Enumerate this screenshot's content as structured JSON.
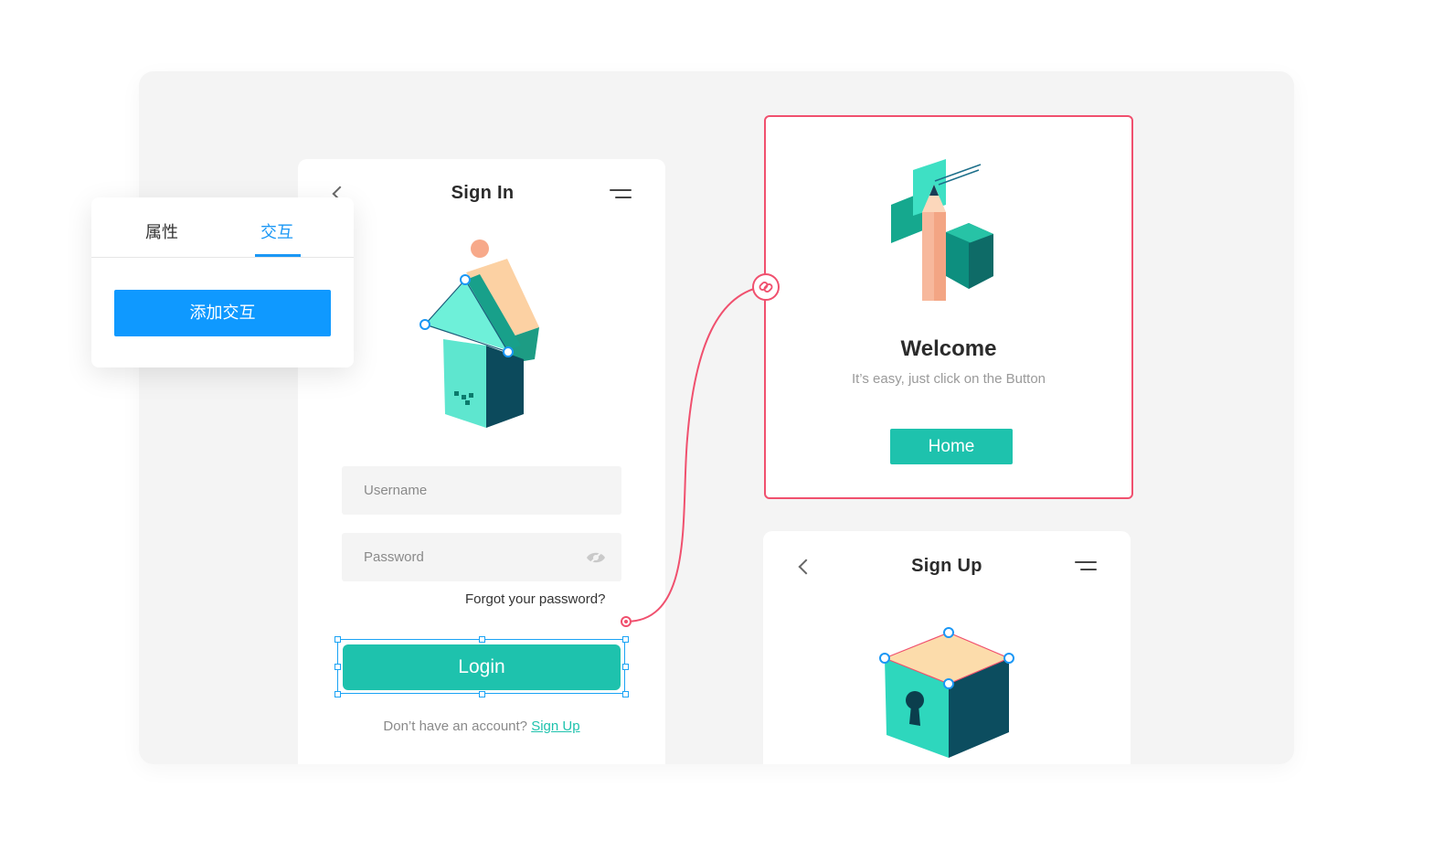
{
  "signin": {
    "title": "Sign In",
    "username_placeholder": "Username",
    "password_placeholder": "Password",
    "forgot_label": "Forgot your password?",
    "login_label": "Login",
    "no_account_text": "Don’t have an account?",
    "signup_link": "Sign Up"
  },
  "properties_panel": {
    "tabs": [
      "属性",
      "交互"
    ],
    "active_tab": "交互",
    "add_interaction_label": "添加交互"
  },
  "welcome": {
    "title": "Welcome",
    "subtitle": "It’s easy, just click on the Button",
    "home_label": "Home"
  },
  "signup_screen": {
    "title": "Sign Up"
  },
  "icons": [
    "back-icon",
    "menu-icon",
    "eye-hidden-icon",
    "link-icon",
    "arrow-house-illustration",
    "pencil-illustration",
    "lock-cube-illustration"
  ],
  "colors": {
    "accent_teal": "#1ec2ad",
    "accent_blue": "#0f99ff",
    "link_red": "#f0506e",
    "selection_blue": "#1aa3f5"
  }
}
